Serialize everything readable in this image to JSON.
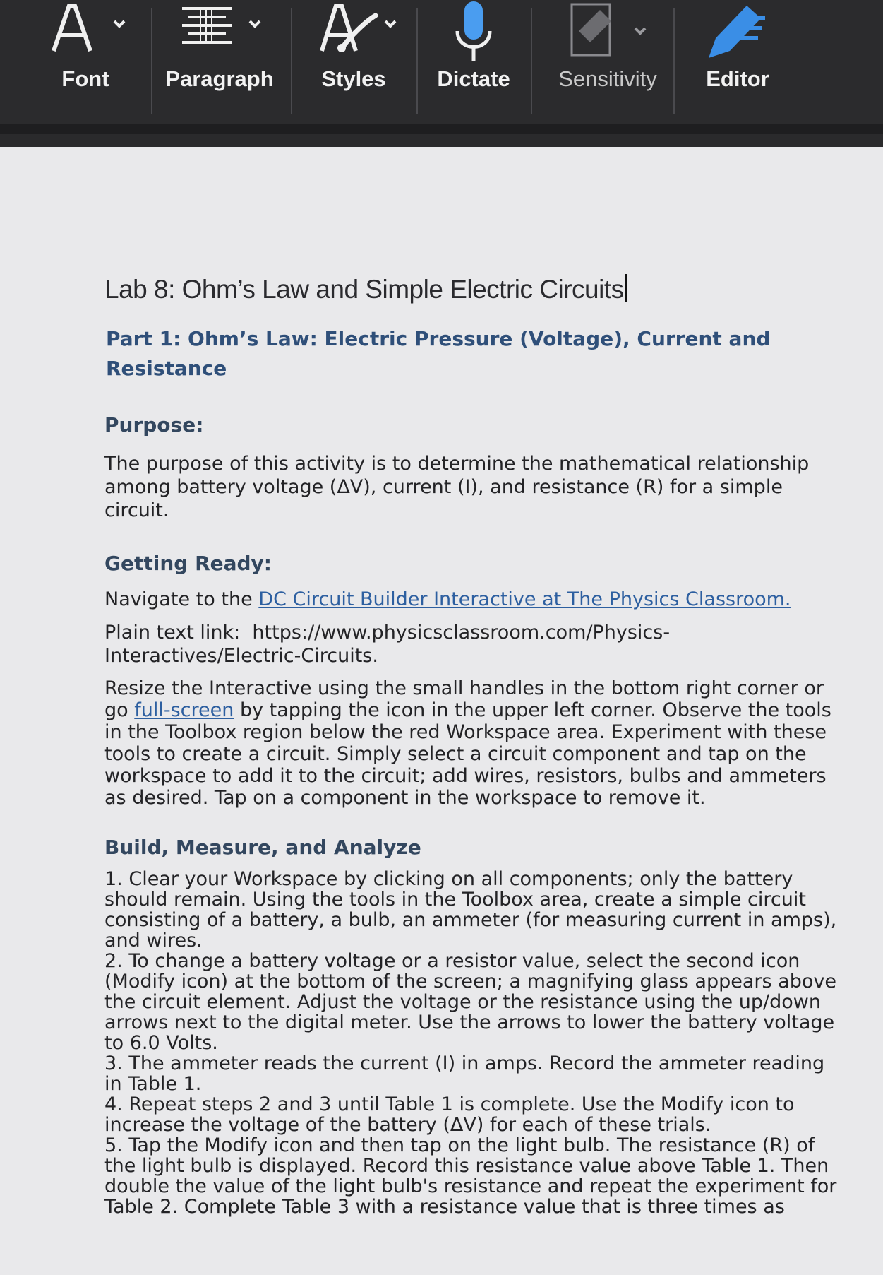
{
  "toolbar": {
    "font_label": "Font",
    "paragraph_label": "Paragraph",
    "styles_label": "Styles",
    "dictate_label": "Dictate",
    "sensitivity_label": "Sensitivity",
    "editor_label": "Editor",
    "colors": {
      "background": "#2b2b2d",
      "label": "#f2f2f2",
      "editor_accent": "#3a8ee6",
      "dictate_accent": "#4a9df0"
    },
    "icons": [
      "font-icon",
      "paragraph-icon",
      "styles-icon",
      "microphone-icon",
      "sensitivity-icon",
      "editor-pen-icon",
      "chevron-down-icon"
    ]
  },
  "document": {
    "title": "Lab 8: Ohm’s Law and Simple Electric Circuits",
    "part1_heading": "Part 1: Ohm’s Law: Electric Pressure (Voltage), Current and Resistance",
    "purpose_heading": "Purpose:",
    "purpose_text": "The purpose of this activity is to determine the mathematical relationship among battery voltage (ΔV), current (I), and resistance (R) for a simple circuit.",
    "getting_ready_heading": "Getting Ready:",
    "navigate_prefix": "Navigate to the ",
    "navigate_link": "DC Circuit Builder Interactive at The Physics Classroom.",
    "plain_link_label": "Plain text link:",
    "plain_link_url": "https://www.physicsclassroom.com/Physics-Interactives/Electric-Circuits.",
    "resize_prefix": "Resize the Interactive using the small handles in the bottom right corner or go ",
    "resize_link": "full-screen",
    "resize_suffix": " by tapping the icon in the upper left corner. Observe the tools in the Toolbox region below the red Workspace area. Experiment with these tools to create a circuit. Simply select a circuit component and tap on the workspace to add it to the circuit; add wires, resistors, bulbs and ammeters as desired. Tap on a component in the workspace to remove it.",
    "build_heading": "Build, Measure, and Analyze",
    "steps": [
      "1. Clear your Workspace by clicking on all components; only the battery should remain. Using the tools in the Toolbox area, create a simple circuit consisting of a battery, a bulb, an ammeter (for measuring current in amps), and wires.",
      "2. To change a battery voltage or a resistor value, select the second icon (Modify icon) at the bottom of the screen; a magnifying glass appears above the circuit element. Adjust the voltage or the resistance using the up/down arrows next to the digital meter. Use the arrows to lower the battery voltage to 6.0 Volts.",
      "3. The ammeter reads the current (I) in amps. Record the ammeter reading in Table 1.",
      "4. Repeat steps 2 and 3 until Table 1 is complete. Use the Modify icon to increase the voltage of the battery (ΔV) for each of these trials.",
      "5. Tap the Modify icon and then tap on the light bulb. The resistance (R) of the light bulb is displayed. Record this resistance value above Table 1. Then double the value of the light bulb's resistance and repeat the experiment for Table 2. Complete Table 3 with a resistance value that is three times as"
    ]
  }
}
